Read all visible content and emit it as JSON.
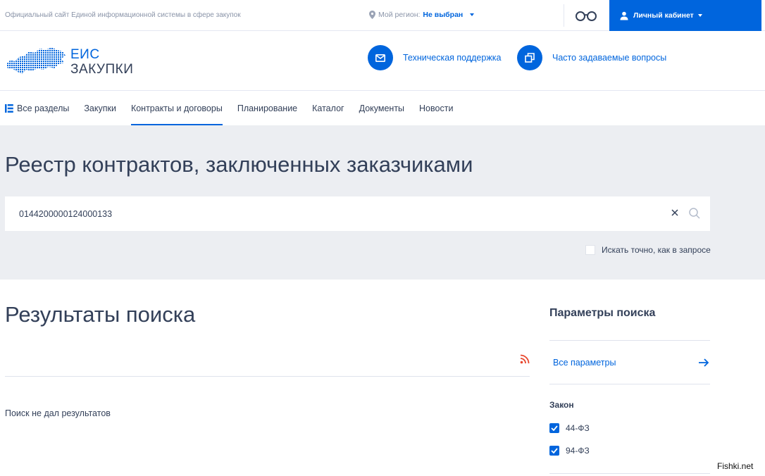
{
  "topbar": {
    "site_description": "Официальный сайт Единой информационной системы в сфере закупок",
    "region_label": "Мой регион:",
    "region_value": "Не выбран",
    "cabinet_label": "Личный кабинет"
  },
  "header": {
    "logo_line1": "ЕИС",
    "logo_line2": "ЗАКУПКИ",
    "support_label": "Техническая поддержка",
    "faq_label": "Часто задаваемые вопросы"
  },
  "nav": {
    "items": [
      {
        "label": "Все разделы"
      },
      {
        "label": "Закупки"
      },
      {
        "label": "Контракты и договоры"
      },
      {
        "label": "Планирование"
      },
      {
        "label": "Каталог"
      },
      {
        "label": "Документы"
      },
      {
        "label": "Новости"
      }
    ],
    "active_index": 2
  },
  "search": {
    "title": "Реестр контрактов, заключенных заказчиками",
    "query": "0144200000124000133",
    "exact_label": "Искать точно, как в запросе",
    "exact_checked": false
  },
  "results": {
    "title": "Результаты поиска",
    "empty_message": "Поиск не дал результатов"
  },
  "params": {
    "title": "Параметры поиска",
    "all_params_label": "Все параметры",
    "law_title": "Закон",
    "laws": [
      {
        "label": "44-ФЗ",
        "checked": true
      },
      {
        "label": "94-ФЗ",
        "checked": true
      }
    ]
  },
  "watermark": "Fishki.net",
  "colors": {
    "accent": "#0065dd",
    "text": "#334059",
    "band_bg": "#eceef2",
    "rss": "#e8472e"
  }
}
